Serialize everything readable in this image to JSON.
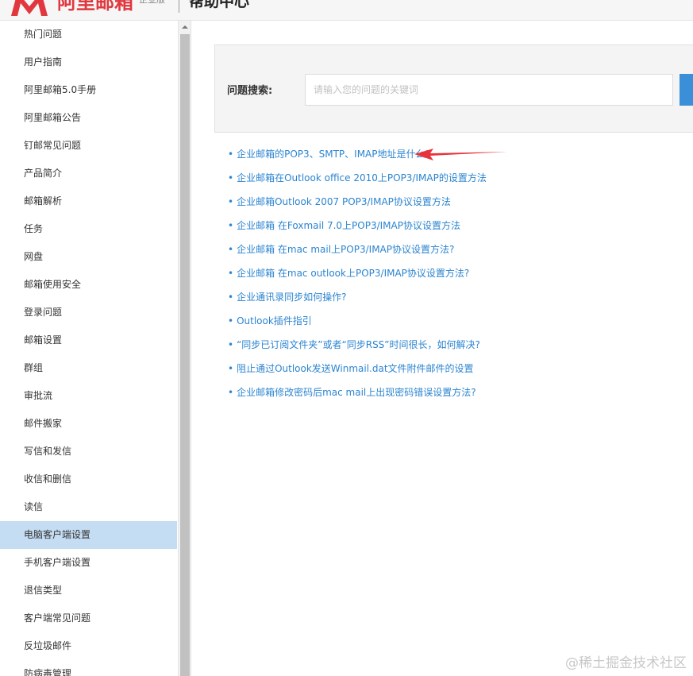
{
  "header": {
    "logo_text": "阿里邮箱",
    "edition": "企业版",
    "title": "帮助中心"
  },
  "sidebar": {
    "items": [
      {
        "label": "热门问题"
      },
      {
        "label": "用户指南"
      },
      {
        "label": "阿里邮箱5.0手册"
      },
      {
        "label": "阿里邮箱公告"
      },
      {
        "label": "钉邮常见问题"
      },
      {
        "label": "产品简介"
      },
      {
        "label": "邮箱解析"
      },
      {
        "label": "任务"
      },
      {
        "label": "网盘"
      },
      {
        "label": "邮箱使用安全"
      },
      {
        "label": "登录问题"
      },
      {
        "label": "邮箱设置"
      },
      {
        "label": "群组"
      },
      {
        "label": "审批流"
      },
      {
        "label": "邮件搬家"
      },
      {
        "label": "写信和发信"
      },
      {
        "label": "收信和删信"
      },
      {
        "label": "读信"
      },
      {
        "label": "电脑客户端设置",
        "active": true
      },
      {
        "label": "手机客户端设置"
      },
      {
        "label": "退信类型"
      },
      {
        "label": "客户端常见问题"
      },
      {
        "label": "反垃圾邮件"
      },
      {
        "label": "防病毒管理"
      }
    ]
  },
  "search": {
    "label": "问题搜索:",
    "placeholder": "请输入您的问题的关键词"
  },
  "faq": {
    "bullet": "•",
    "items": [
      "企业邮箱的POP3、SMTP、IMAP地址是什么?",
      "企业邮箱在Outlook office 2010上POP3/IMAP的设置方法",
      "企业邮箱Outlook 2007 POP3/IMAP协议设置方法",
      "企业邮箱 在Foxmail 7.0上POP3/IMAP协议设置方法",
      "企业邮箱 在mac mail上POP3/IMAP协议设置方法?",
      "企业邮箱 在mac outlook上POP3/IMAP协议设置方法?",
      "企业通讯录同步如何操作?",
      "Outlook插件指引",
      "“同步已订阅文件夹”或者“同步RSS”时间很长，如何解决?",
      "阻止通过Outlook发送Winmail.dat文件附件邮件的设置",
      "企业邮箱修改密码后mac mail上出现密码错误设置方法?"
    ]
  },
  "watermark": "@稀土掘金技术社区",
  "colors": {
    "brand_red": "#e0383e",
    "link_blue": "#2b84d0",
    "active_bg": "#c4ddf2",
    "button_blue": "#3b8fd9"
  }
}
